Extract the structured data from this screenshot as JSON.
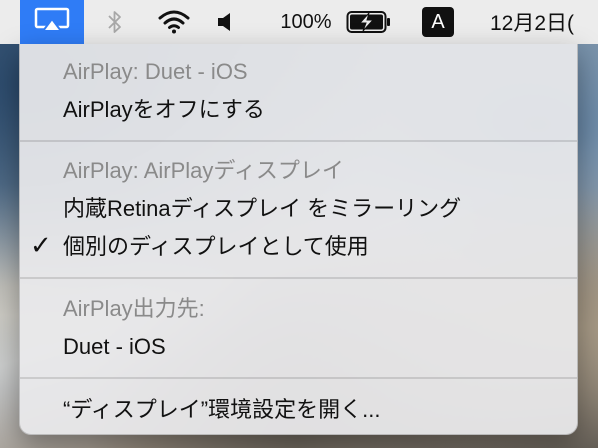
{
  "menubar": {
    "airplay_icon": "airplay-icon",
    "bluetooth_icon": "bluetooth-icon",
    "wifi_icon": "wifi-icon",
    "volume_icon": "volume-icon",
    "battery_percent": "100%",
    "battery_icon": "battery-charging-icon",
    "input_source": "A",
    "clock": "12月2日("
  },
  "menu": {
    "section1_header": "AirPlay: Duet - iOS",
    "turn_off_airplay": "AirPlayをオフにする",
    "section2_header": "AirPlay: AirPlayディスプレイ",
    "mirror_builtin": "内蔵Retinaディスプレイ をミラーリング",
    "separate_display_check": "✓",
    "separate_display": "個別のディスプレイとして使用",
    "section3_header": "AirPlay出力先:",
    "output_duet": "Duet - iOS",
    "open_display_prefs": "“ディスプレイ”環境設定を開く..."
  }
}
